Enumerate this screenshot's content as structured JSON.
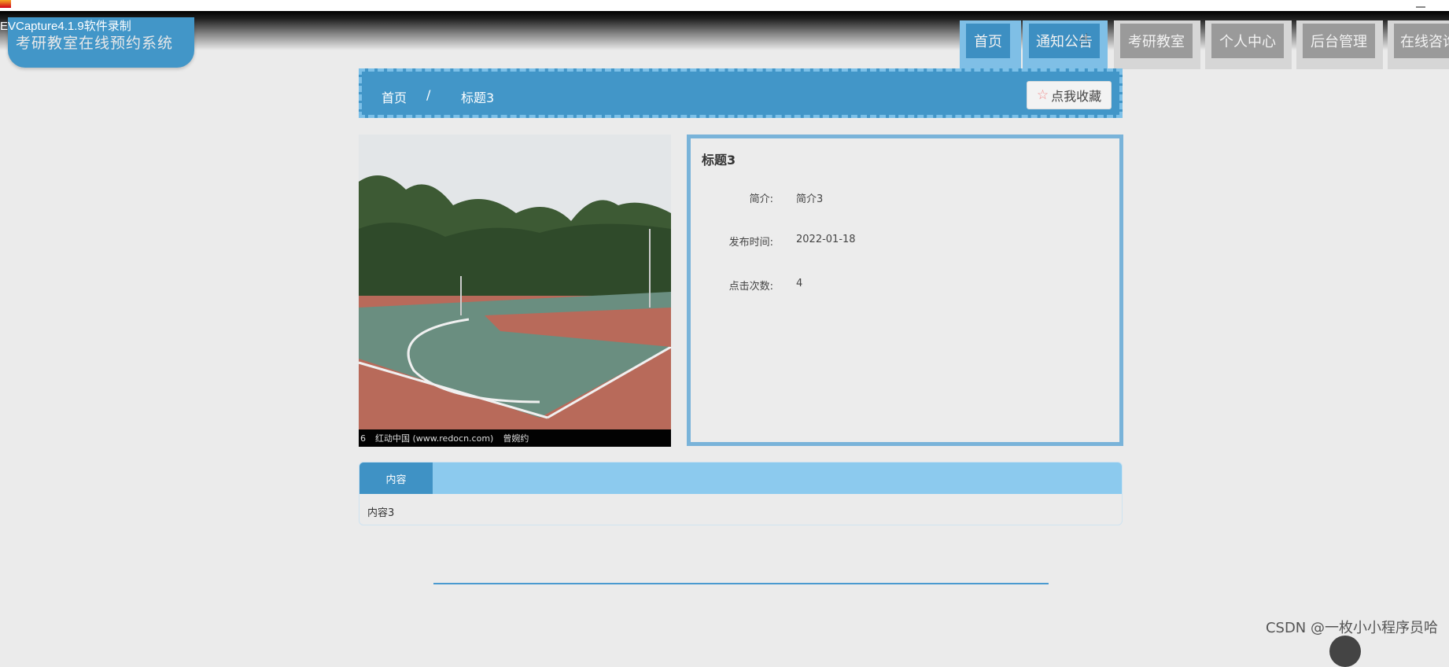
{
  "capture": {
    "label": "EVCapture4.1.9软件录制"
  },
  "site": {
    "title": "考研教室在线预约系统"
  },
  "nav": {
    "items": [
      {
        "label": "首页",
        "active": true
      },
      {
        "label": "通知公告",
        "active": true
      },
      {
        "label": "考研教室",
        "active": false
      },
      {
        "label": "个人中心",
        "active": false
      },
      {
        "label": "后台管理",
        "active": false
      },
      {
        "label": "在线咨询",
        "active": false
      }
    ]
  },
  "breadcrumb": {
    "home": "首页",
    "separator": "/",
    "current": "标题3"
  },
  "favorite": {
    "label": "点我收藏",
    "icon": "star-outline-icon"
  },
  "photo": {
    "caption_num": "6",
    "caption_source": "红动中国 (www.redocn.com)",
    "caption_author": "曾婉约"
  },
  "detail": {
    "title": "标题3",
    "rows": [
      {
        "label": "简介:",
        "value": "简介3"
      },
      {
        "label": "发布时间:",
        "value": "2022-01-18"
      },
      {
        "label": "点击次数:",
        "value": "4"
      }
    ]
  },
  "content": {
    "tab_label": "内容",
    "text": "内容3"
  },
  "watermark": "CSDN @一枚小小程序员哈",
  "colors": {
    "primary": "#4296c8",
    "light": "#8ccaee",
    "background": "#ebebeb"
  }
}
